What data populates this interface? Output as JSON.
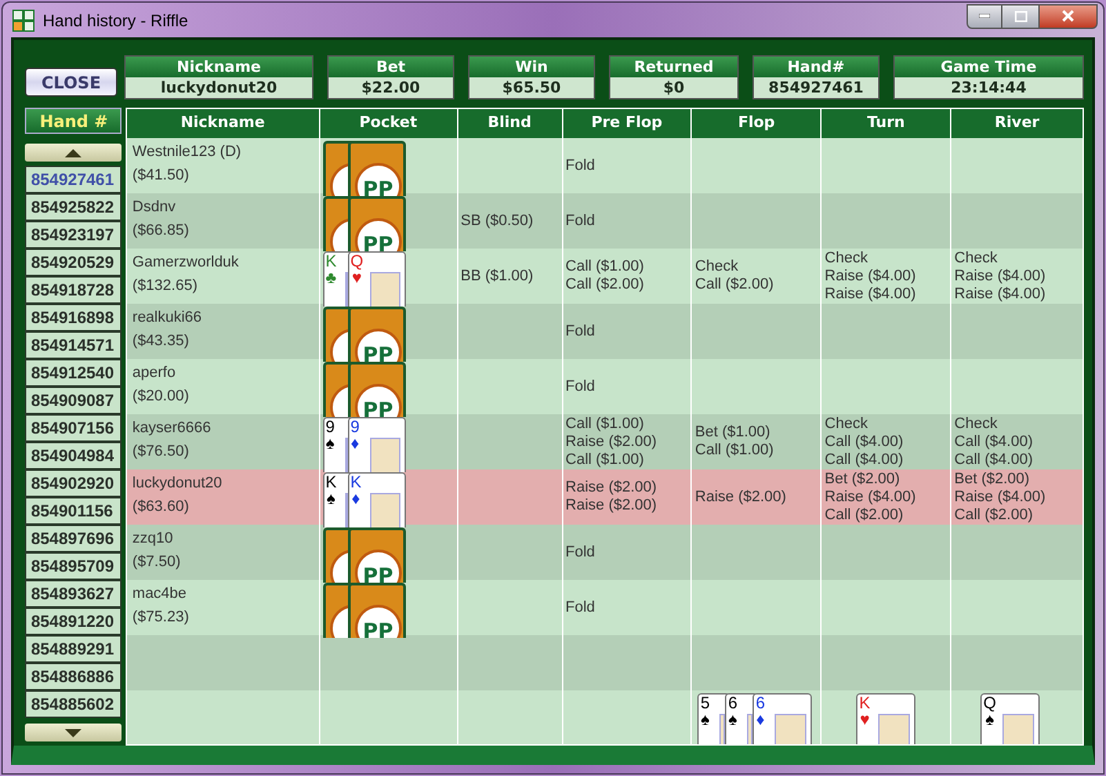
{
  "window": {
    "title": "Hand history - Riffle"
  },
  "close_button": "CLOSE",
  "summary": [
    {
      "label": "Nickname",
      "value": "luckydonut20"
    },
    {
      "label": "Bet",
      "value": "$22.00"
    },
    {
      "label": "Win",
      "value": "$65.50"
    },
    {
      "label": "Returned",
      "value": "$0"
    },
    {
      "label": "Hand#",
      "value": "854927461"
    },
    {
      "label": "Game Time",
      "value": "23:14:44"
    }
  ],
  "hand_list": {
    "title": "Hand #",
    "items": [
      {
        "label": "854927461",
        "selected": true
      },
      {
        "label": "854925822",
        "selected": false
      },
      {
        "label": "854923197",
        "selected": false
      },
      {
        "label": "854920529",
        "selected": false
      },
      {
        "label": "854918728",
        "selected": false
      },
      {
        "label": "854916898",
        "selected": false
      },
      {
        "label": "854914571",
        "selected": false
      },
      {
        "label": "854912540",
        "selected": false
      },
      {
        "label": "854909087",
        "selected": false
      },
      {
        "label": "854907156",
        "selected": false
      },
      {
        "label": "854904984",
        "selected": false
      },
      {
        "label": "854902920",
        "selected": false
      },
      {
        "label": "854901156",
        "selected": false
      },
      {
        "label": "854897696",
        "selected": false
      },
      {
        "label": "854895709",
        "selected": false
      },
      {
        "label": "854893627",
        "selected": false
      },
      {
        "label": "854891220",
        "selected": false
      },
      {
        "label": "854889291",
        "selected": false
      },
      {
        "label": "854886886",
        "selected": false
      },
      {
        "label": "854885602",
        "selected": false
      }
    ]
  },
  "table": {
    "columns": [
      "Nickname",
      "Pocket",
      "Blind",
      "Pre Flop",
      "Flop",
      "Turn",
      "River"
    ],
    "rows": [
      {
        "nickname": "Westnile123 (D)",
        "stack": "($41.50)",
        "highlighted": false,
        "pocket": {
          "kind": "hidden",
          "logo": "PP"
        },
        "blind": "",
        "preflop": [
          "Fold"
        ],
        "flop": [],
        "turn": [],
        "river": []
      },
      {
        "nickname": "Dsdnv",
        "stack": "($66.85)",
        "highlighted": false,
        "pocket": {
          "kind": "hidden",
          "logo": "PP"
        },
        "blind": "SB ($0.50)",
        "preflop": [
          "Fold"
        ],
        "flop": [],
        "turn": [],
        "river": []
      },
      {
        "nickname": "Gamerzworlduk",
        "stack": "($132.65)",
        "highlighted": false,
        "pocket": {
          "kind": "shown",
          "cards": [
            {
              "rank": "K",
              "suit": "♣",
              "color": "#2f8a2f"
            },
            {
              "rank": "Q",
              "suit": "♥",
              "color": "#e02020"
            }
          ]
        },
        "blind": "BB ($1.00)",
        "preflop": [
          "Call ($1.00)",
          "Call ($2.00)"
        ],
        "flop": [
          "Check",
          "Call ($2.00)"
        ],
        "turn": [
          "Check",
          "Raise ($4.00)",
          "Raise ($4.00)"
        ],
        "river": [
          "Check",
          "Raise ($4.00)",
          "Raise ($4.00)"
        ]
      },
      {
        "nickname": "realkuki66",
        "stack": "($43.35)",
        "highlighted": false,
        "pocket": {
          "kind": "hidden",
          "logo": "PP"
        },
        "blind": "",
        "preflop": [
          "Fold"
        ],
        "flop": [],
        "turn": [],
        "river": []
      },
      {
        "nickname": "aperfo",
        "stack": "($20.00)",
        "highlighted": false,
        "pocket": {
          "kind": "hidden",
          "logo": "PP"
        },
        "blind": "",
        "preflop": [
          "Fold"
        ],
        "flop": [],
        "turn": [],
        "river": []
      },
      {
        "nickname": "kayser6666",
        "stack": "($76.50)",
        "highlighted": false,
        "pocket": {
          "kind": "shown",
          "cards": [
            {
              "rank": "9",
              "suit": "♠",
              "color": "#000000"
            },
            {
              "rank": "9",
              "suit": "♦",
              "color": "#1a3ae0"
            }
          ]
        },
        "blind": "",
        "preflop": [
          "Call ($1.00)",
          "Raise ($2.00)",
          "Call ($1.00)"
        ],
        "flop": [
          "Bet ($1.00)",
          "Call ($1.00)"
        ],
        "turn": [
          "Check",
          "Call ($4.00)",
          "Call ($4.00)"
        ],
        "river": [
          "Check",
          "Call ($4.00)",
          "Call ($4.00)"
        ]
      },
      {
        "nickname": "luckydonut20",
        "stack": "($63.60)",
        "highlighted": true,
        "pocket": {
          "kind": "shown",
          "cards": [
            {
              "rank": "K",
              "suit": "♠",
              "color": "#000000"
            },
            {
              "rank": "K",
              "suit": "♦",
              "color": "#1a3ae0"
            }
          ]
        },
        "blind": "",
        "preflop": [
          "Raise ($2.00)",
          "Raise ($2.00)"
        ],
        "flop": [
          "Raise ($2.00)"
        ],
        "turn": [
          "Bet ($2.00)",
          "Raise ($4.00)",
          "Call ($2.00)"
        ],
        "river": [
          "Bet ($2.00)",
          "Raise ($4.00)",
          "Call ($2.00)"
        ]
      },
      {
        "nickname": "zzq10",
        "stack": "($7.50)",
        "highlighted": false,
        "pocket": {
          "kind": "hidden",
          "logo": "PP"
        },
        "blind": "",
        "preflop": [
          "Fold"
        ],
        "flop": [],
        "turn": [],
        "river": []
      },
      {
        "nickname": "mac4be",
        "stack": "($75.23)",
        "highlighted": false,
        "pocket": {
          "kind": "hidden",
          "logo": "PP"
        },
        "blind": "",
        "preflop": [
          "Fold"
        ],
        "flop": [],
        "turn": [],
        "river": []
      }
    ],
    "board": {
      "flop": [
        {
          "rank": "5",
          "suit": "♠",
          "color": "#000000"
        },
        {
          "rank": "6",
          "suit": "♠",
          "color": "#000000"
        },
        {
          "rank": "6",
          "suit": "♦",
          "color": "#1a3ae0"
        }
      ],
      "turn": [
        {
          "rank": "K",
          "suit": "♥",
          "color": "#e02020"
        }
      ],
      "river": [
        {
          "rank": "Q",
          "suit": "♠",
          "color": "#000000"
        }
      ]
    }
  }
}
